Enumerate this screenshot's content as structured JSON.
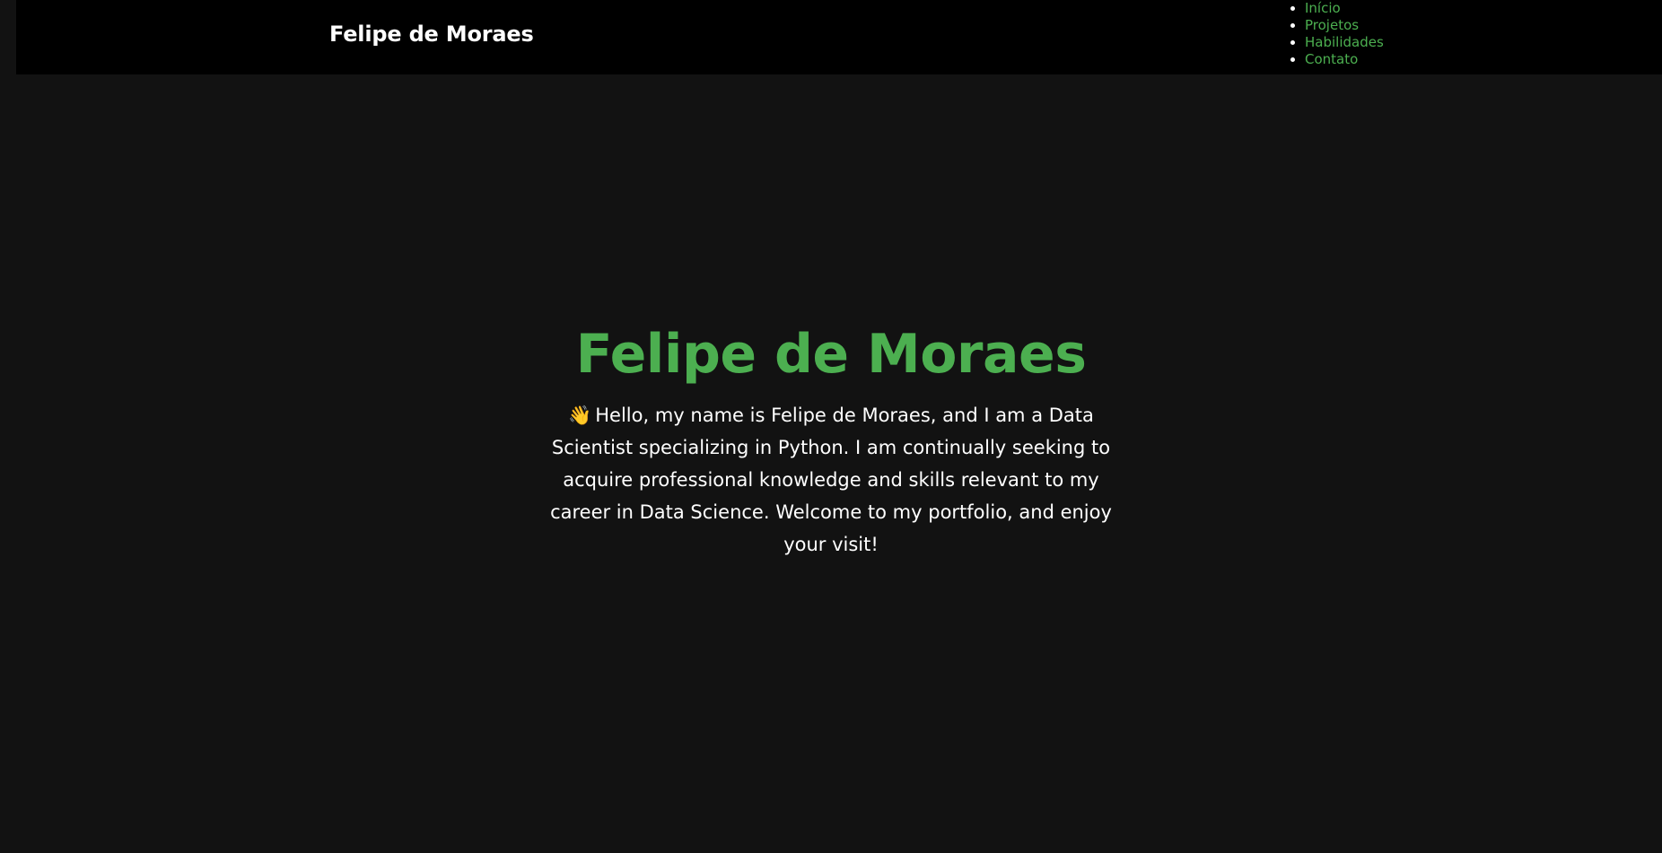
{
  "header": {
    "brand": "Felipe de Moraes",
    "nav": [
      {
        "label": "Início"
      },
      {
        "label": "Projetos"
      },
      {
        "label": "Habilidades"
      },
      {
        "label": "Contato"
      }
    ]
  },
  "hero": {
    "title": "Felipe de Moraes",
    "icon": "waving-hand-icon",
    "text": "Hello, my name is Felipe de Moraes, and I am a Data Scientist specializing in Python. I am continually seeking to acquire professional knowledge and skills relevant to my career in Data Science. Welcome to my portfolio, and enjoy your visit!"
  },
  "colors": {
    "accent": "#4caf50",
    "header_bg": "#000000",
    "page_bg": "#121212",
    "text": "#ffffff"
  }
}
